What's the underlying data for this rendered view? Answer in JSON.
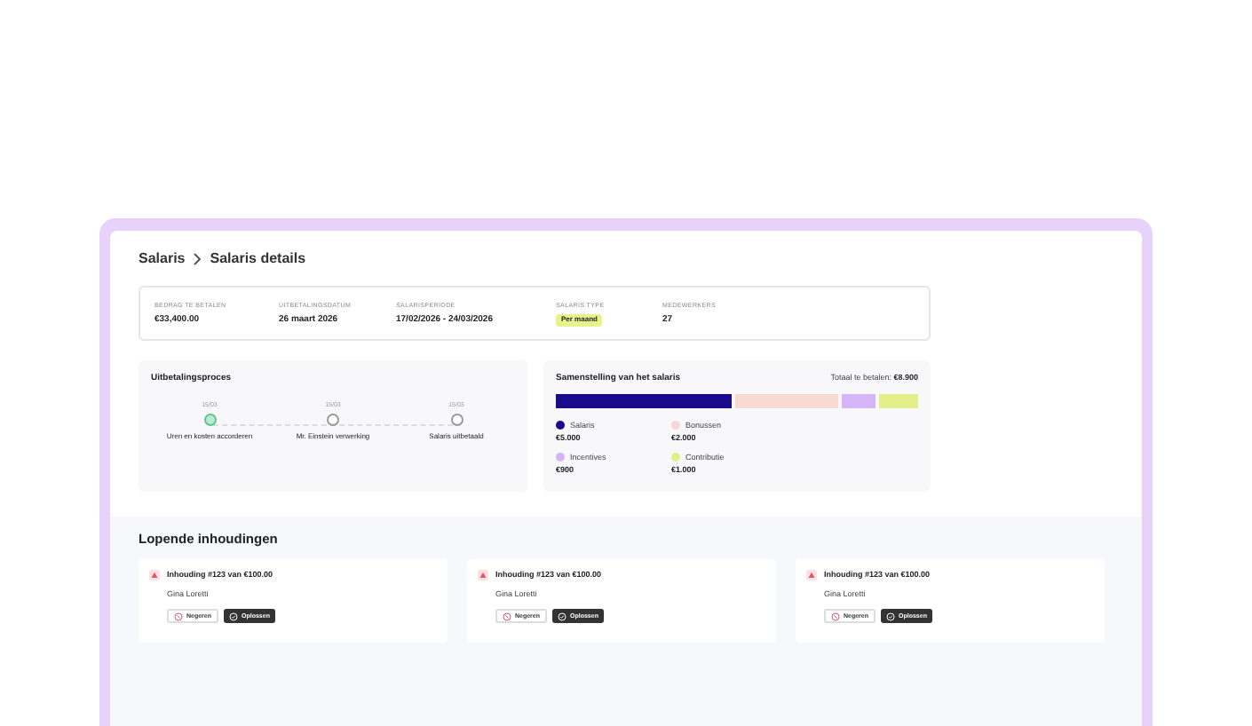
{
  "breadcrumb": [
    {
      "label": "Salaris"
    },
    {
      "label": "Salaris details"
    }
  ],
  "summary": [
    {
      "label": "BEDRAG TE BETALEN",
      "value": "€33,400.00"
    },
    {
      "label": "UITBETALINGSDATUM",
      "value": "26 maart 2026"
    },
    {
      "label": "SALARISPERIODE",
      "value": "17/02/2026 - 24/03/2026"
    },
    {
      "label": "SALARIS TYPE",
      "badge": "Per maand"
    },
    {
      "label": "MEDEWERKERS",
      "value": "27"
    }
  ],
  "process": {
    "title": "Uitbetalingsproces",
    "steps": [
      {
        "date": "15/03",
        "label": "Uren en kosten accorderen",
        "done": true
      },
      {
        "date": "15/03",
        "label": "Mr. Einstein verwerking",
        "done": false
      },
      {
        "date": "15/03",
        "label": "Salaris uitbetaald",
        "done": false
      }
    ]
  },
  "composition": {
    "title": "Samenstelling van het salaris",
    "total_label": "Totaal te betalen:",
    "total": "€8.900",
    "parts": [
      {
        "name": "Salaris",
        "amount": "€5.000",
        "color": "#1a0a8c"
      },
      {
        "name": "Bonussen",
        "amount": "€2.000",
        "color": "#f8d8d2"
      },
      {
        "name": "Incentives",
        "amount": "€900",
        "color": "#d4b5f7"
      },
      {
        "name": "Contributie",
        "amount": "€1.000",
        "color": "#e4ef8a"
      }
    ]
  },
  "deductions": {
    "title": "Lopende inhoudingen",
    "items": [
      {
        "title": "Inhouding #123 van €100.00",
        "person": "Gina Loretti",
        "reject": "Negeren",
        "resolve": "Oplossen"
      },
      {
        "title": "Inhouding #123 van €100.00",
        "person": "Gina Loretti",
        "reject": "Negeren",
        "resolve": "Oplossen"
      },
      {
        "title": "Inhouding #123 van €100.00",
        "person": "Gina Loretti",
        "reject": "Negeren",
        "resolve": "Oplossen"
      }
    ]
  }
}
